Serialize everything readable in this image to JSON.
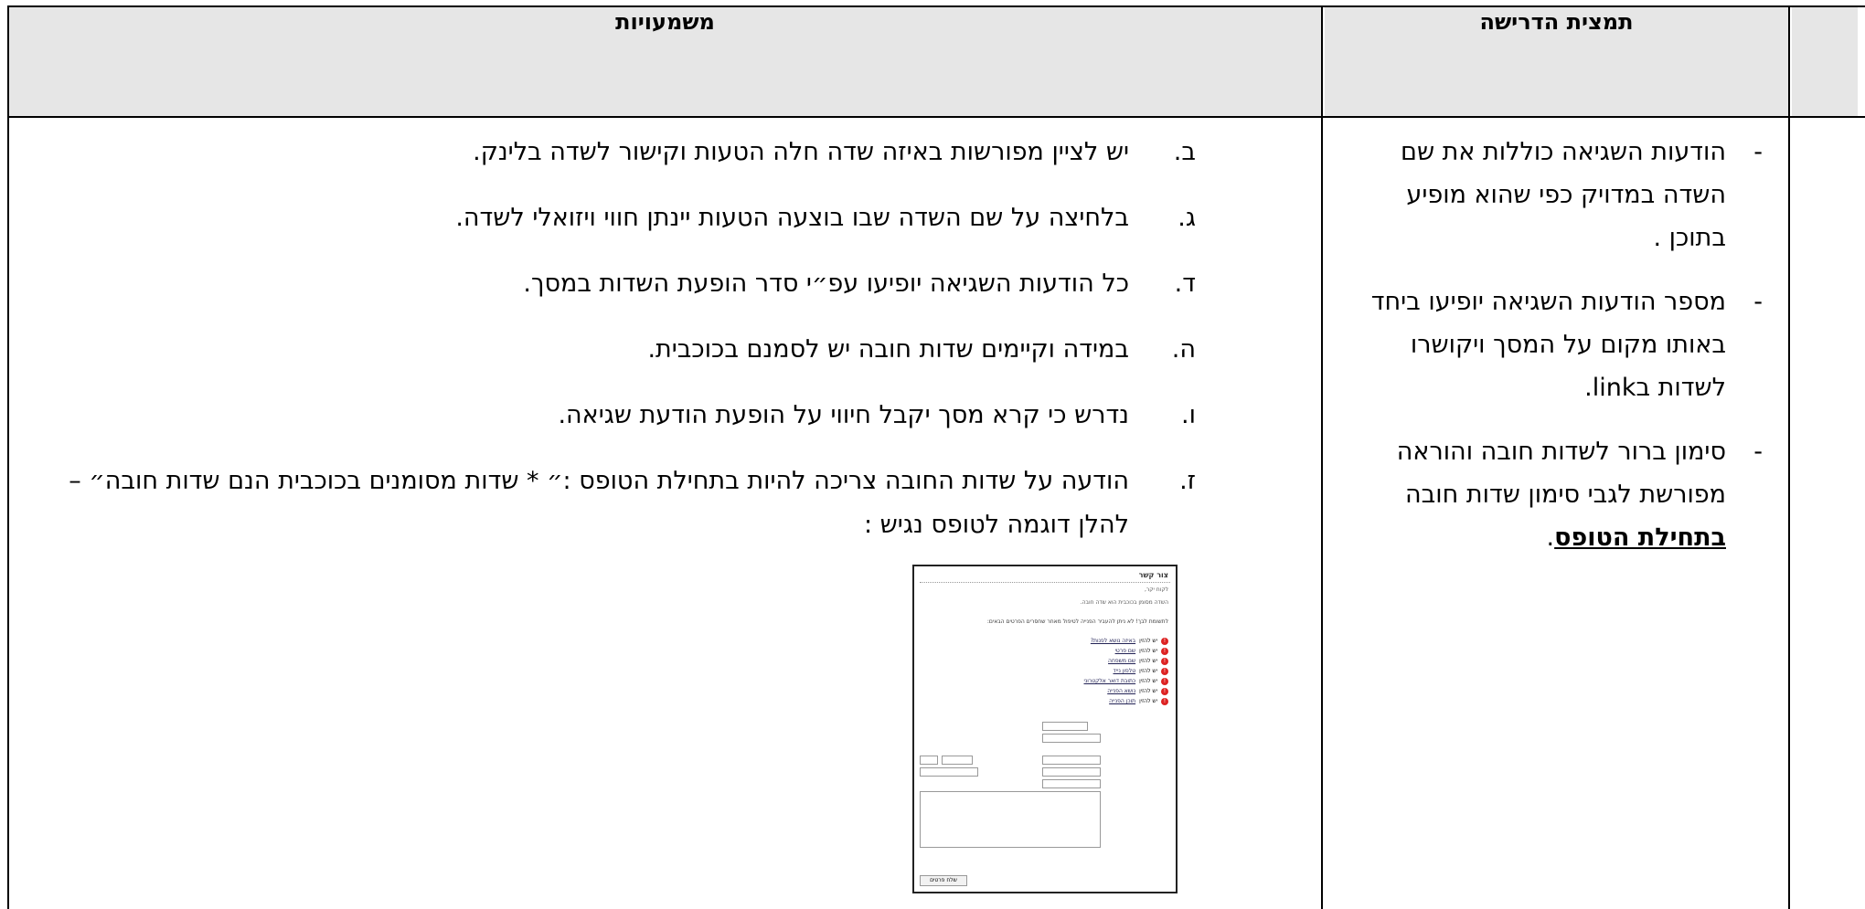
{
  "table": {
    "headers": {
      "requirement": "תמצית הדרישה",
      "meanings": "משמעויות"
    }
  },
  "requirements": [
    {
      "dash": "-",
      "lines": [
        "הודעות השגיאה כוללות את שם",
        "השדה במדויק כפי שהוא מופיע",
        "בתוכן ."
      ]
    },
    {
      "dash": "-",
      "lines": [
        "מספר הודעות השגיאה יופיעו ביחד",
        "באותו מקום על המסך ויקושרו",
        "לשדות בlink."
      ]
    },
    {
      "dash": "-",
      "lines": [
        "סימון ברור לשדות חובה והוראה",
        "מפורשת לגבי סימון שדות חובה"
      ],
      "emphasis": "בתחילת הטופס",
      "trailing": "."
    }
  ],
  "meanings": [
    {
      "letter": "ב.",
      "lines": [
        "יש לציין מפורשות באיזה שדה חלה הטעות וקישור לשדה בלינק."
      ]
    },
    {
      "letter": "ג.",
      "lines": [
        "בלחיצה על שם השדה שבו בוצעה הטעות יינתן חווי ויזואלי לשדה."
      ]
    },
    {
      "letter": "ד.",
      "lines": [
        "כל הודעות השגיאה יופיעו עפ״י סדר הופעת השדות במסך."
      ]
    },
    {
      "letter": "ה.",
      "lines": [
        "במידה וקיימים שדות חובה יש לסמנם בכוכבית."
      ]
    },
    {
      "letter": "ו.",
      "lines": [
        "נדרש כי קרא מסך יקבל חיווי על הופעת הודעת שגיאה."
      ]
    },
    {
      "letter": "ז.",
      "lines": [
        "הודעה על שדות החובה צריכה להיות בתחילת הטופס :״ * שדות מסומנים בכוכבית הנם שדות חובה״ –",
        "להלן דוגמה לטופס נגיש :"
      ]
    }
  ],
  "example_form": {
    "title": "צור קשר",
    "greeting": "לקוח יקר,",
    "note": "השדה מסומן בכוכבית הוא שדה חובה.",
    "warning": "לתשומת לבך! לא ניתן להעביר הפנייה לטיפול מאחר שחסרים הפרטים הבאים:",
    "errors": [
      {
        "prefix": "יש להזין",
        "field": "באיזה נושא לפנות?"
      },
      {
        "prefix": "יש להזין",
        "field": "שם פרטי"
      },
      {
        "prefix": "יש להזין",
        "field": "שם משפחה"
      },
      {
        "prefix": "יש להזין",
        "field": "טלפון נייד"
      },
      {
        "prefix": "יש להזין",
        "field": "כתובת דואר אלקטרוני"
      },
      {
        "prefix": "יש להזין",
        "field": "נושא הפנייה"
      },
      {
        "prefix": "יש להזין",
        "field": "תוכן הפנייה"
      }
    ],
    "submit_label": "שלח פרטים"
  }
}
